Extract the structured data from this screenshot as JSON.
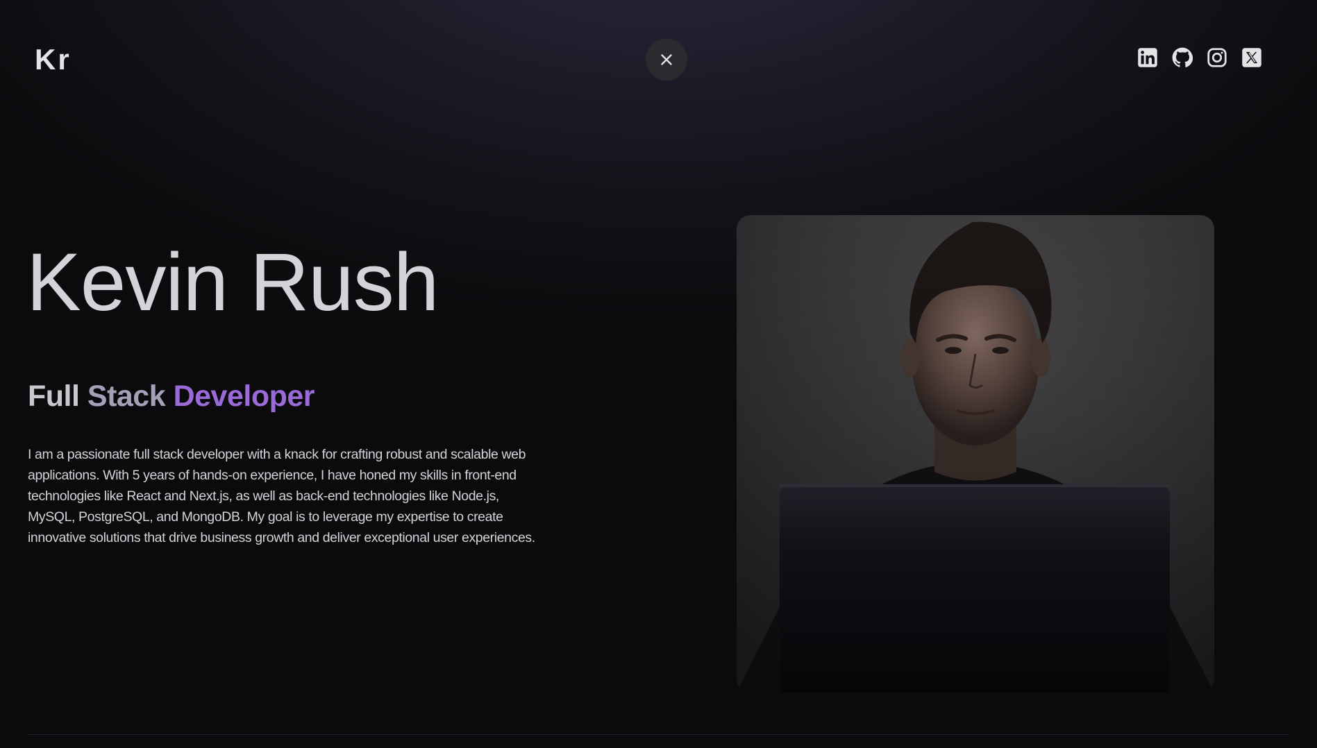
{
  "header": {
    "logo": "Kr",
    "close_icon": "close-icon",
    "socials": [
      {
        "icon": "linkedin-icon"
      },
      {
        "icon": "github-icon"
      },
      {
        "icon": "instagram-icon"
      },
      {
        "icon": "x-twitter-icon"
      }
    ]
  },
  "hero": {
    "name": "Kevin Rush",
    "role_words": [
      "Full",
      "Stack",
      "Developer"
    ],
    "bio": "I am a passionate full stack developer with a knack for crafting robust and scalable web applications. With 5 years of hands-on experience, I have honed my skills in front-end technologies like React and Next.js, as well as back-end technologies like Node.js, MySQL, PostgreSQL, and MongoDB. My goal is to leverage my expertise to create innovative solutions that drive business growth and deliver exceptional user experiences."
  },
  "colors": {
    "accent": "#9a6bd8",
    "background": "#0b0b0d",
    "text": "#d4d4d8"
  }
}
